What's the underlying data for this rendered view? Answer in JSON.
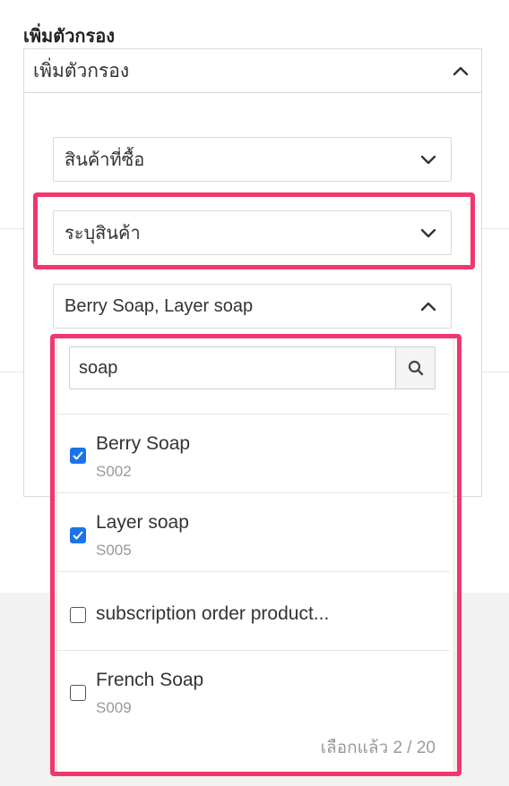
{
  "section_title": "เพิ่มตัวกรอง",
  "add_filter": {
    "label": "เพิ่มตัวกรอง",
    "expanded": true
  },
  "filters": [
    {
      "label": "สินค้าที่ซื้อ",
      "expanded": false
    },
    {
      "label": "ระบุสินค้า",
      "expanded": false,
      "highlighted": true
    },
    {
      "label": "Berry Soap, Layer soap",
      "expanded": true
    }
  ],
  "dropdown": {
    "search": {
      "value": "soap",
      "icon": "search-icon"
    },
    "options": [
      {
        "name": "Berry Soap",
        "code": "S002",
        "checked": true
      },
      {
        "name": "Layer soap",
        "code": "S005",
        "checked": true
      },
      {
        "name": "subscription order product...",
        "code": "",
        "checked": false
      },
      {
        "name": "French Soap",
        "code": "S009",
        "checked": false
      }
    ],
    "selected_count_text": "เลือกแล้ว 2 / 20"
  },
  "colors": {
    "highlight": "#f0376e",
    "checkbox_checked": "#1a73e8",
    "muted_text": "#999999",
    "border": "#d9d9d9"
  }
}
